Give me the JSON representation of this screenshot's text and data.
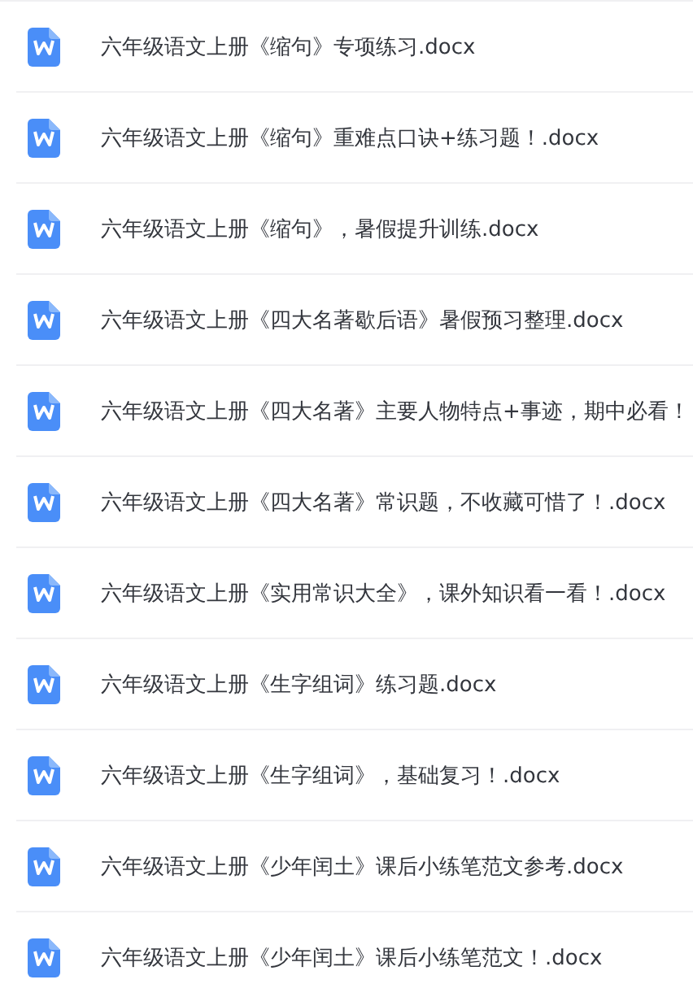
{
  "files": [
    {
      "name": "六年级语文上册《缩句》专项练习.docx"
    },
    {
      "name": "六年级语文上册《缩句》重难点口诀+练习题！.docx"
    },
    {
      "name": "六年级语文上册《缩句》，暑假提升训练.docx"
    },
    {
      "name": "六年级语文上册《四大名著歇后语》暑假预习整理.docx"
    },
    {
      "name": "六年级语文上册《四大名著》主要人物特点+事迹，期中必看！"
    },
    {
      "name": "六年级语文上册《四大名著》常识题，不收藏可惜了！.docx"
    },
    {
      "name": "六年级语文上册《实用常识大全》，课外知识看一看！.docx"
    },
    {
      "name": "六年级语文上册《生字组词》练习题.docx"
    },
    {
      "name": "六年级语文上册《生字组词》，基础复习！.docx"
    },
    {
      "name": "六年级语文上册《少年闰土》课后小练笔范文参考.docx"
    },
    {
      "name": "六年级语文上册《少年闰土》课后小练笔范文！.docx"
    }
  ]
}
